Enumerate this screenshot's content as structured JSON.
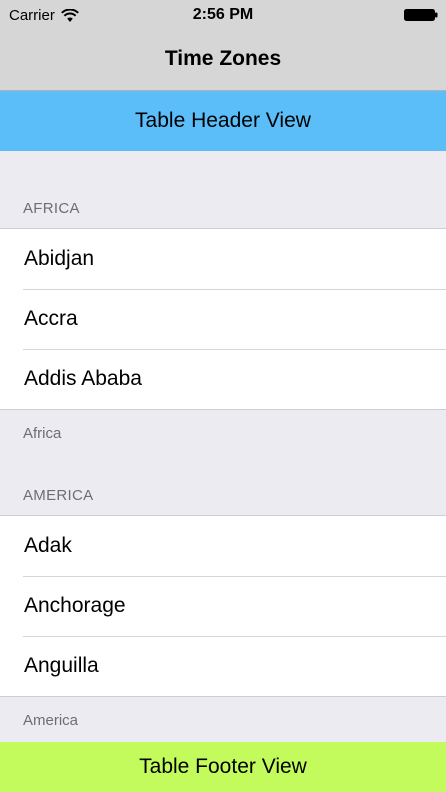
{
  "status_bar": {
    "carrier": "Carrier",
    "time": "2:56 PM"
  },
  "nav": {
    "title": "Time Zones"
  },
  "table_header": "Table Header View",
  "sections": [
    {
      "title": "AFRICA",
      "rows": [
        "Abidjan",
        "Accra",
        "Addis Ababa"
      ],
      "footer": "Africa"
    },
    {
      "title": "AMERICA",
      "rows": [
        "Adak",
        "Anchorage",
        "Anguilla"
      ],
      "footer": "America"
    }
  ],
  "table_footer": "Table Footer View",
  "colors": {
    "header_bg": "#5bbef9",
    "footer_bg": "#c2fb5b",
    "grouped_bg": "#ebebf1"
  },
  "icons": [
    "wifi-icon",
    "battery-icon"
  ]
}
